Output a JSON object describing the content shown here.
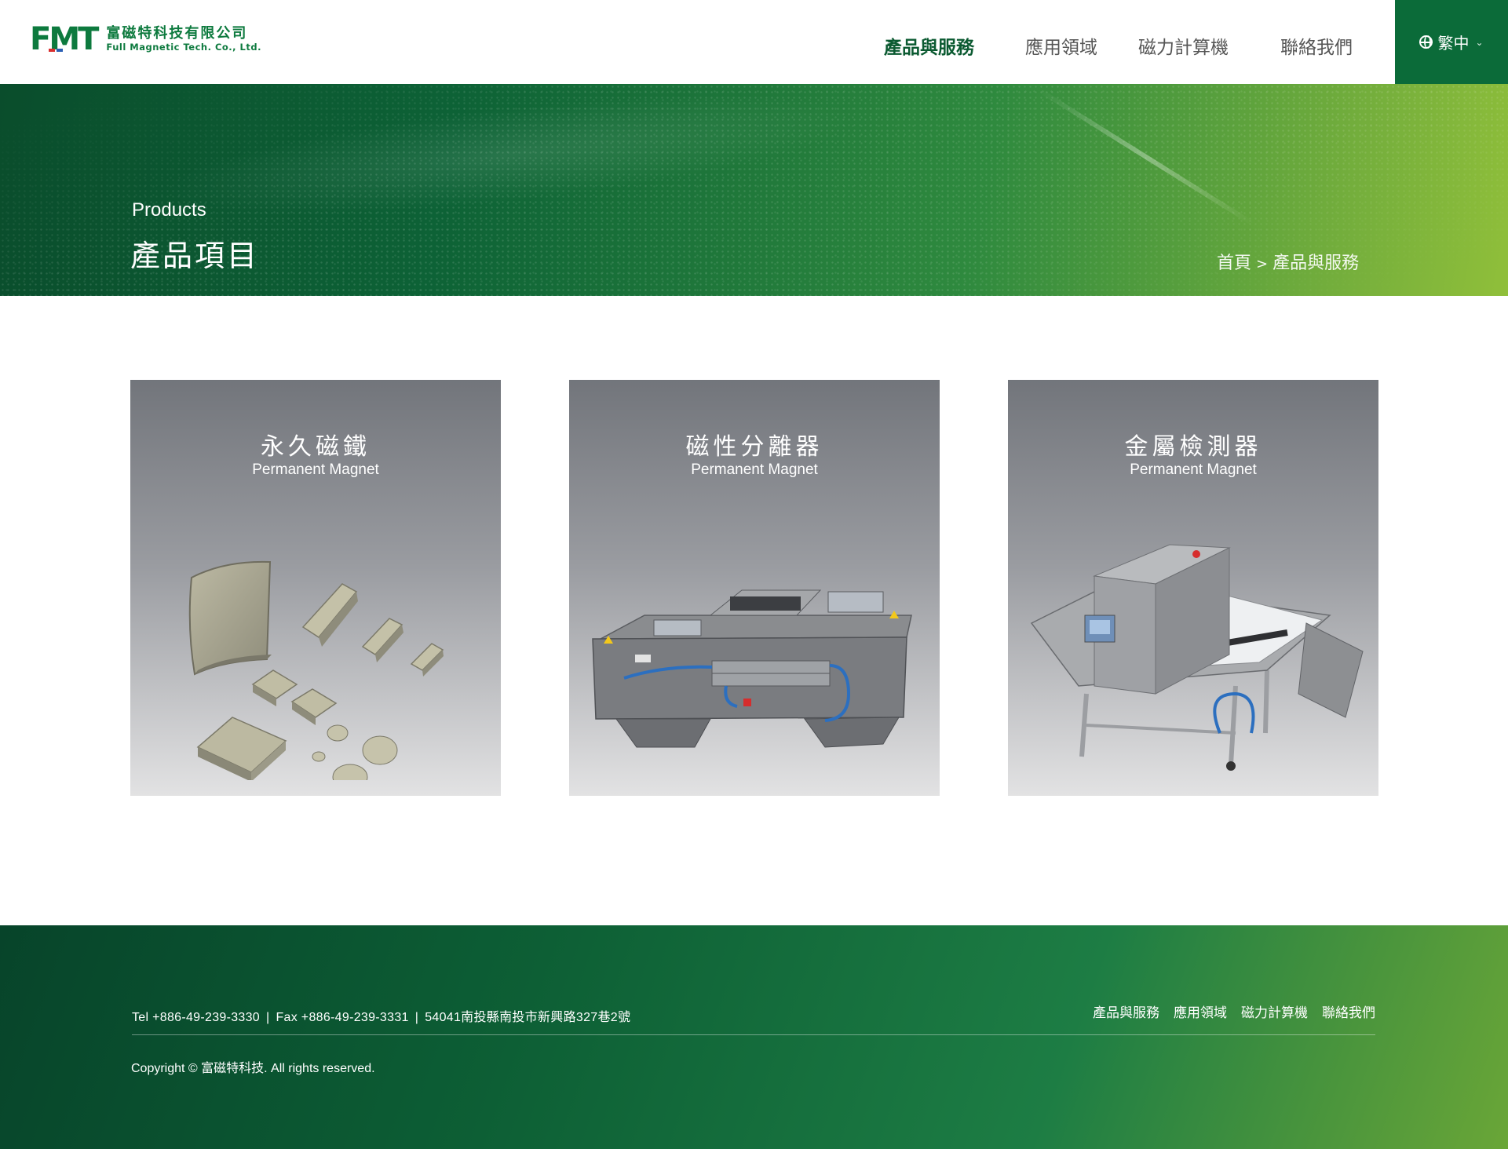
{
  "header": {
    "logo_mark": "FMT",
    "logo_name_zh": "富磁特科技有限公司",
    "logo_name_en": "Full Magnetic Tech. Co., Ltd.",
    "nav": [
      {
        "label": "產品與服務",
        "active": true
      },
      {
        "label": "應用領域",
        "active": false
      },
      {
        "label": "磁力計算機",
        "active": false
      },
      {
        "label": "聯絡我們",
        "active": false
      }
    ],
    "language": {
      "label": "繁中",
      "icon": "globe-icon"
    }
  },
  "banner": {
    "subtitle": "Products",
    "title": "產品項目",
    "breadcrumb": {
      "home": "首頁",
      "separator": ">",
      "current": "產品與服務"
    }
  },
  "products": [
    {
      "title": "永久磁鐵",
      "subtitle": "Permanent Magnet",
      "image": "permanent-magnets-image"
    },
    {
      "title": "磁性分離器",
      "subtitle": "Permanent Magnet",
      "image": "magnetic-separator-image"
    },
    {
      "title": "金屬檢測器",
      "subtitle": "Permanent Magnet",
      "image": "metal-detector-image"
    }
  ],
  "footer": {
    "tel": "Tel +886-49-239-3330",
    "fax": "Fax +886-49-239-3331",
    "address": "54041南投縣南投市新興路327巷2號",
    "separator": "|",
    "links": [
      "產品與服務",
      "應用領域",
      "磁力計算機",
      "聯絡我們"
    ],
    "copyright": "Copyright © 富磁特科技. All rights reserved."
  },
  "colors": {
    "brand_green": "#0b6b39",
    "nav_active": "#0b5a31",
    "footer_light_green": "#6aa637"
  }
}
